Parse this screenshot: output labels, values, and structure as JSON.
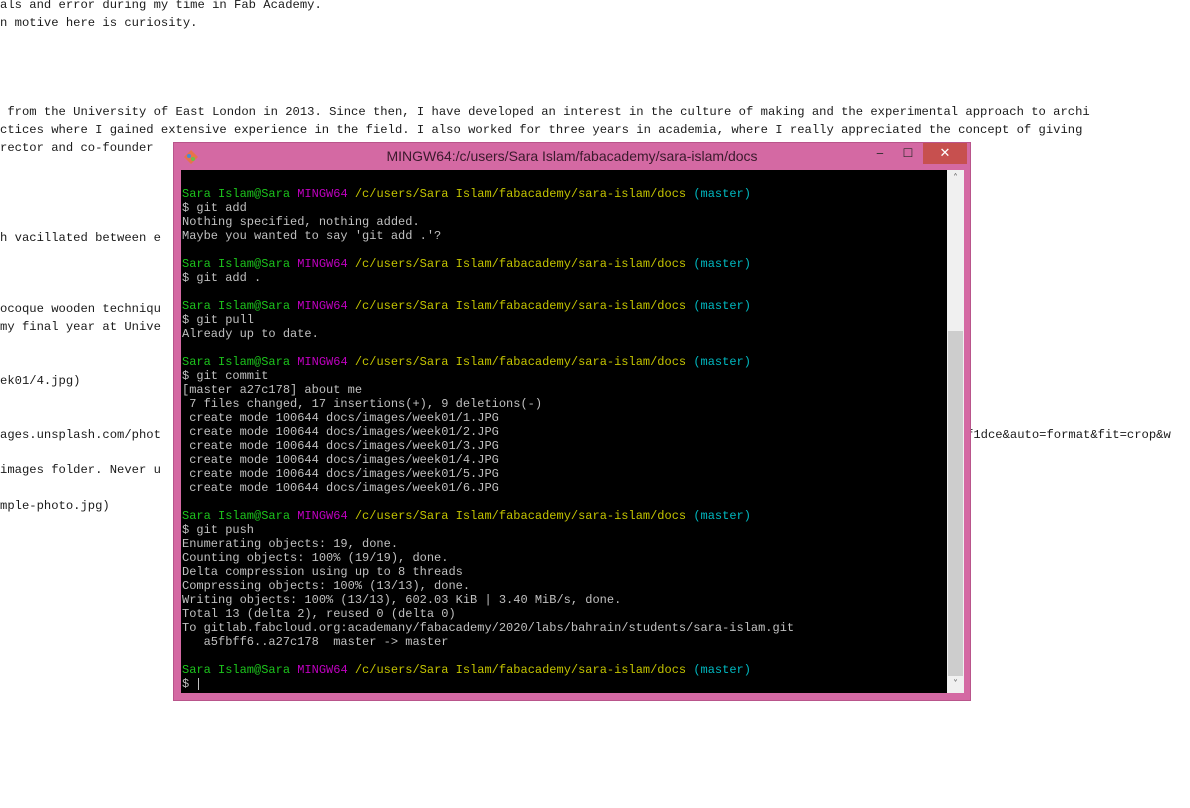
{
  "background_text": [
    {
      "text": "als and error during my time in Fab Academy.",
      "row": 0
    },
    {
      "text": "n motive here is curiosity.",
      "row": 1
    },
    {
      "text": " from the University of East London in 2013. Since then, I have developed an interest in the culture of making and the experimental approach to archi",
      "row": 6
    },
    {
      "text": "ctices where I gained extensive experience in the field. I also worked for three years in academia, where I really appreciated the concept of giving",
      "row": 7
    },
    {
      "text": "rector and co-founder",
      "row": 8
    },
    {
      "text": "h vacillated between e",
      "row": 13
    },
    {
      "text": "ocoque wooden techniqu",
      "row": 17
    },
    {
      "text": "my final year at Unive",
      "row": 18
    },
    {
      "text": "ek01/4.jpg)",
      "row": 21
    },
    {
      "text": "ages.unsplash.com/phot",
      "row": 24
    },
    {
      "text": "f1dce&auto=format&fit=crop&w",
      "row": 24,
      "indent": 966
    },
    {
      "text": "images folder. Never u",
      "row": 26
    },
    {
      "text": "mple-photo.jpg)",
      "row": 28
    }
  ],
  "window": {
    "title": "MINGW64:/c/users/Sara Islam/fabacademy/sara-islam/docs",
    "minimize": "‒",
    "maximize": "☐",
    "close": "✕"
  },
  "prompt": {
    "user": "Sara Islam@Sara",
    "host": "MINGW64",
    "path": "/c/users/Sara Islam/fabacademy/sara-islam/docs",
    "branch": "(master)"
  },
  "terminal_lines": [
    {
      "type": "prompt"
    },
    {
      "type": "text",
      "text": "$ git add"
    },
    {
      "type": "text",
      "text": "Nothing specified, nothing added."
    },
    {
      "type": "text",
      "text": "Maybe you wanted to say 'git add .'?"
    },
    {
      "type": "blank"
    },
    {
      "type": "prompt"
    },
    {
      "type": "text",
      "text": "$ git add ."
    },
    {
      "type": "blank"
    },
    {
      "type": "prompt"
    },
    {
      "type": "text",
      "text": "$ git pull"
    },
    {
      "type": "text",
      "text": "Already up to date."
    },
    {
      "type": "blank"
    },
    {
      "type": "prompt"
    },
    {
      "type": "text",
      "text": "$ git commit"
    },
    {
      "type": "text",
      "text": "[master a27c178] about me"
    },
    {
      "type": "text",
      "text": " 7 files changed, 17 insertions(+), 9 deletions(-)"
    },
    {
      "type": "text",
      "text": " create mode 100644 docs/images/week01/1.JPG"
    },
    {
      "type": "text",
      "text": " create mode 100644 docs/images/week01/2.JPG"
    },
    {
      "type": "text",
      "text": " create mode 100644 docs/images/week01/3.JPG"
    },
    {
      "type": "text",
      "text": " create mode 100644 docs/images/week01/4.JPG"
    },
    {
      "type": "text",
      "text": " create mode 100644 docs/images/week01/5.JPG"
    },
    {
      "type": "text",
      "text": " create mode 100644 docs/images/week01/6.JPG"
    },
    {
      "type": "blank"
    },
    {
      "type": "prompt"
    },
    {
      "type": "text",
      "text": "$ git push"
    },
    {
      "type": "text",
      "text": "Enumerating objects: 19, done."
    },
    {
      "type": "text",
      "text": "Counting objects: 100% (19/19), done."
    },
    {
      "type": "text",
      "text": "Delta compression using up to 8 threads"
    },
    {
      "type": "text",
      "text": "Compressing objects: 100% (13/13), done."
    },
    {
      "type": "text",
      "text": "Writing objects: 100% (13/13), 602.03 KiB | 3.40 MiB/s, done."
    },
    {
      "type": "text",
      "text": "Total 13 (delta 2), reused 0 (delta 0)"
    },
    {
      "type": "text",
      "text": "To gitlab.fabcloud.org:academany/fabacademy/2020/labs/bahrain/students/sara-islam.git"
    },
    {
      "type": "text",
      "text": "   a5fbff6..a27c178  master -> master"
    },
    {
      "type": "blank"
    },
    {
      "type": "prompt"
    },
    {
      "type": "input",
      "text": "$"
    }
  ],
  "scrollbar": {
    "up": "˄",
    "down": "˅",
    "position_fraction": 1.0
  },
  "colors": {
    "title_bar": "#d469a3",
    "close_button": "#c7504f",
    "prompt_user": "#1cc41c",
    "prompt_host": "#bf00bf",
    "prompt_path": "#c4c400",
    "prompt_branch": "#00b8c0",
    "terminal_text": "#c0c0c0"
  }
}
